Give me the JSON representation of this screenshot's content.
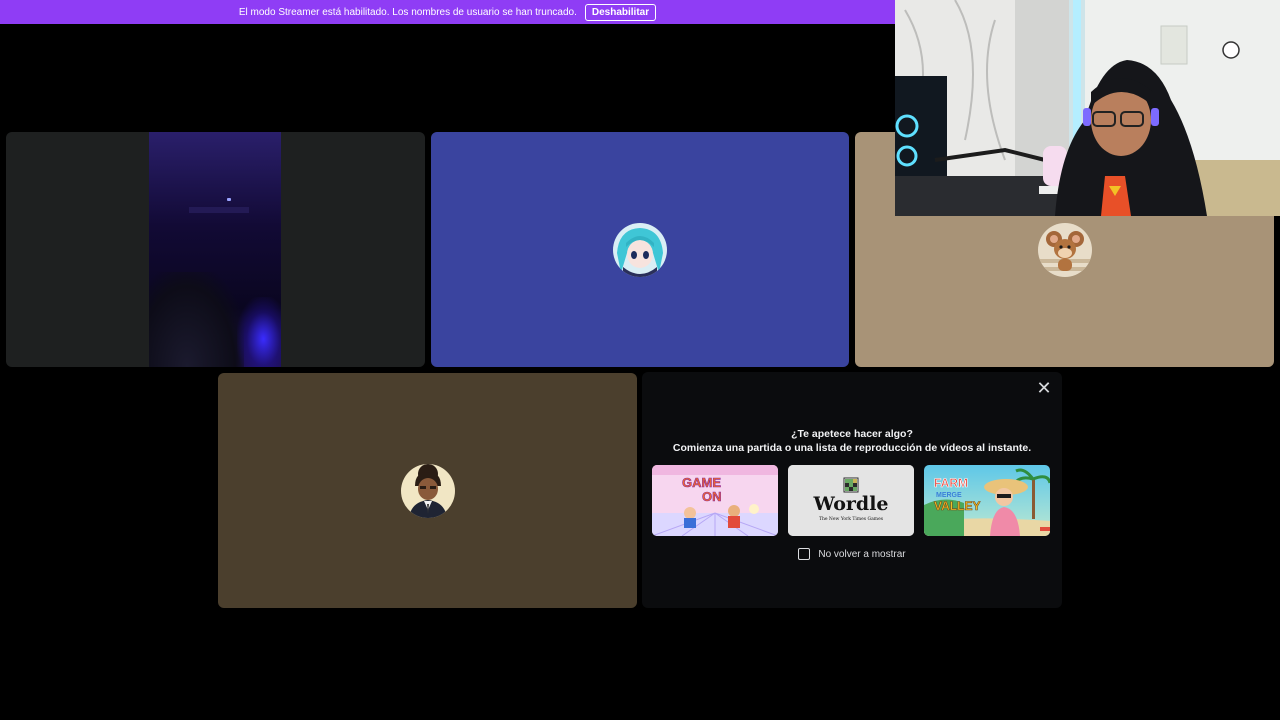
{
  "banner": {
    "message": "El modo Streamer está habilitado. Los nombres de usuario se han truncado.",
    "button_label": "Deshabilitar",
    "color": "#8f3df5"
  },
  "tiles": [
    {
      "id": "camera-user",
      "background": "#1e2020",
      "content": "video-feed"
    },
    {
      "id": "anime-avatar-user",
      "background": "#3a449f",
      "avatar_icon": "anime-girl-avatar"
    },
    {
      "id": "jerry-avatar-user",
      "background": "#a89377",
      "avatar_icon": "cartoon-mouse-avatar"
    },
    {
      "id": "suit-avatar-user",
      "background": "#4b3f2d",
      "avatar_icon": "cartoon-man-avatar"
    }
  ],
  "activity_panel": {
    "title": "¿Te apetece hacer algo?",
    "subtitle": "Comienza una partida o una lista de reproducción de vídeos al instante.",
    "close_icon": "close-icon",
    "cards": [
      {
        "name": "gameon",
        "title_line1": "GAME",
        "title_line2": "ON"
      },
      {
        "name": "wordle",
        "title": "Wordle",
        "subtitle": "The New York Times Games"
      },
      {
        "name": "farm-merge-valley",
        "title_line1": "FARM",
        "title_line2": "MERGE",
        "title_line3": "VALLEY"
      }
    ],
    "dont_show_label": "No volver a mostrar"
  },
  "webcam": {
    "content": "streamer-webcam"
  }
}
